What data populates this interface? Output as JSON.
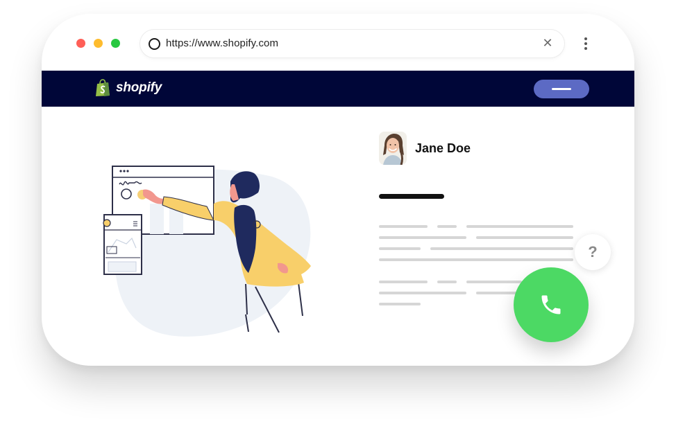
{
  "browser": {
    "url": "https://www.shopify.com",
    "close_icon": "close-icon",
    "menu_icon": "kebab-menu-icon"
  },
  "site": {
    "brand": "shopify",
    "logo_icon": "shopify-bag-icon",
    "menu_button_icon": "hamburger-icon"
  },
  "profile": {
    "name": "Jane Doe"
  },
  "widgets": {
    "help_label": "?",
    "call_icon": "phone-icon"
  },
  "colors": {
    "navbar": "#000638",
    "menu_pill": "#5c6ac4",
    "call_button": "#4cd964",
    "shopify_green": "#95bf47"
  }
}
